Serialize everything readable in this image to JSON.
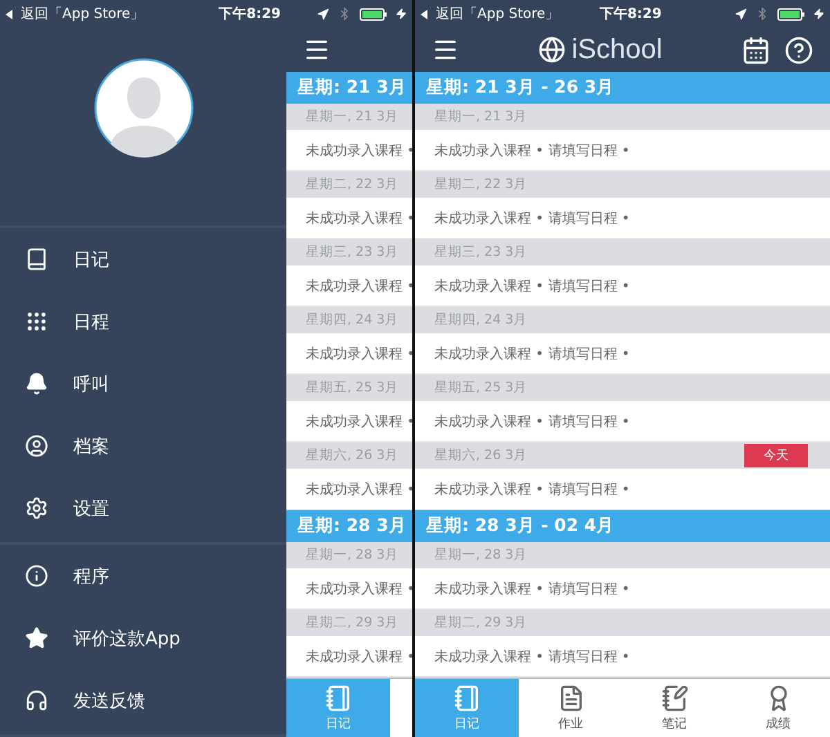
{
  "left_phone": {
    "status_bar": {
      "back": "返回「App Store」",
      "time": "下午8:29"
    },
    "drawer": {
      "sections": [
        [
          {
            "label": "日记"
          },
          {
            "label": "日程"
          },
          {
            "label": "呼叫"
          },
          {
            "label": "档案"
          },
          {
            "label": "设置"
          }
        ],
        [
          {
            "label": "程序"
          },
          {
            "label": "评价这款App"
          },
          {
            "label": "发送反馈"
          }
        ]
      ]
    },
    "app": {
      "weeks": [
        {
          "title": "星期: 21 3月",
          "days": [
            {
              "label": "星期一, 21 3月",
              "entry": "未成功录入课程 •"
            },
            {
              "label": "星期二, 22 3月",
              "entry": "未成功录入课程 •"
            },
            {
              "label": "星期三, 23 3月",
              "entry": "未成功录入课程 •"
            },
            {
              "label": "星期四, 24 3月",
              "entry": "未成功录入课程 •"
            },
            {
              "label": "星期五, 25 3月",
              "entry": "未成功录入课程 •"
            },
            {
              "label": "星期六, 26 3月",
              "entry": "未成功录入课程 •"
            }
          ]
        },
        {
          "title": "星期: 28 3月",
          "days": [
            {
              "label": "星期一, 28 3月",
              "entry": "未成功录入课程 •"
            },
            {
              "label": "星期二, 29 3月",
              "entry": "未成功录入课程 •"
            }
          ]
        }
      ],
      "tabs": [
        {
          "label": "日记",
          "selected": true
        }
      ]
    }
  },
  "right_phone": {
    "status_bar": {
      "back": "返回「App Store」",
      "time": "下午8:29"
    },
    "header": {
      "title": "iSchool"
    },
    "weeks": [
      {
        "title": "星期: 21 3月 - 26 3月",
        "days": [
          {
            "label": "星期一, 21 3月",
            "entry": "未成功录入课程 • 请填写日程 •"
          },
          {
            "label": "星期二, 22 3月",
            "entry": "未成功录入课程 • 请填写日程 •"
          },
          {
            "label": "星期三, 23 3月",
            "entry": "未成功录入课程 • 请填写日程 •"
          },
          {
            "label": "星期四, 24 3月",
            "entry": "未成功录入课程 • 请填写日程 •"
          },
          {
            "label": "星期五, 25 3月",
            "entry": "未成功录入课程 • 请填写日程 •"
          },
          {
            "label": "星期六, 26 3月",
            "entry": "未成功录入课程 • 请填写日程 •",
            "badge": "今天"
          }
        ]
      },
      {
        "title": "星期: 28 3月 - 02 4月",
        "days": [
          {
            "label": "星期一, 28 3月",
            "entry": "未成功录入课程 • 请填写日程 •"
          },
          {
            "label": "星期二, 29 3月",
            "entry": "未成功录入课程 • 请填写日程 •"
          }
        ]
      }
    ],
    "tabs": [
      {
        "label": "日记",
        "selected": true
      },
      {
        "label": "作业",
        "selected": false
      },
      {
        "label": "笔记",
        "selected": false
      },
      {
        "label": "成绩",
        "selected": false
      }
    ]
  }
}
